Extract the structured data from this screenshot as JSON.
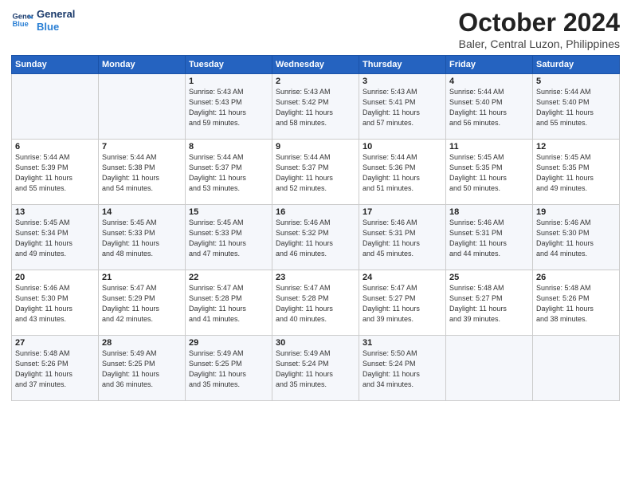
{
  "header": {
    "logo_line1": "General",
    "logo_line2": "Blue",
    "month": "October 2024",
    "location": "Baler, Central Luzon, Philippines"
  },
  "weekdays": [
    "Sunday",
    "Monday",
    "Tuesday",
    "Wednesday",
    "Thursday",
    "Friday",
    "Saturday"
  ],
  "weeks": [
    [
      {
        "day": "",
        "info": ""
      },
      {
        "day": "",
        "info": ""
      },
      {
        "day": "1",
        "info": "Sunrise: 5:43 AM\nSunset: 5:43 PM\nDaylight: 11 hours\nand 59 minutes."
      },
      {
        "day": "2",
        "info": "Sunrise: 5:43 AM\nSunset: 5:42 PM\nDaylight: 11 hours\nand 58 minutes."
      },
      {
        "day": "3",
        "info": "Sunrise: 5:43 AM\nSunset: 5:41 PM\nDaylight: 11 hours\nand 57 minutes."
      },
      {
        "day": "4",
        "info": "Sunrise: 5:44 AM\nSunset: 5:40 PM\nDaylight: 11 hours\nand 56 minutes."
      },
      {
        "day": "5",
        "info": "Sunrise: 5:44 AM\nSunset: 5:40 PM\nDaylight: 11 hours\nand 55 minutes."
      }
    ],
    [
      {
        "day": "6",
        "info": "Sunrise: 5:44 AM\nSunset: 5:39 PM\nDaylight: 11 hours\nand 55 minutes."
      },
      {
        "day": "7",
        "info": "Sunrise: 5:44 AM\nSunset: 5:38 PM\nDaylight: 11 hours\nand 54 minutes."
      },
      {
        "day": "8",
        "info": "Sunrise: 5:44 AM\nSunset: 5:37 PM\nDaylight: 11 hours\nand 53 minutes."
      },
      {
        "day": "9",
        "info": "Sunrise: 5:44 AM\nSunset: 5:37 PM\nDaylight: 11 hours\nand 52 minutes."
      },
      {
        "day": "10",
        "info": "Sunrise: 5:44 AM\nSunset: 5:36 PM\nDaylight: 11 hours\nand 51 minutes."
      },
      {
        "day": "11",
        "info": "Sunrise: 5:45 AM\nSunset: 5:35 PM\nDaylight: 11 hours\nand 50 minutes."
      },
      {
        "day": "12",
        "info": "Sunrise: 5:45 AM\nSunset: 5:35 PM\nDaylight: 11 hours\nand 49 minutes."
      }
    ],
    [
      {
        "day": "13",
        "info": "Sunrise: 5:45 AM\nSunset: 5:34 PM\nDaylight: 11 hours\nand 49 minutes."
      },
      {
        "day": "14",
        "info": "Sunrise: 5:45 AM\nSunset: 5:33 PM\nDaylight: 11 hours\nand 48 minutes."
      },
      {
        "day": "15",
        "info": "Sunrise: 5:45 AM\nSunset: 5:33 PM\nDaylight: 11 hours\nand 47 minutes."
      },
      {
        "day": "16",
        "info": "Sunrise: 5:46 AM\nSunset: 5:32 PM\nDaylight: 11 hours\nand 46 minutes."
      },
      {
        "day": "17",
        "info": "Sunrise: 5:46 AM\nSunset: 5:31 PM\nDaylight: 11 hours\nand 45 minutes."
      },
      {
        "day": "18",
        "info": "Sunrise: 5:46 AM\nSunset: 5:31 PM\nDaylight: 11 hours\nand 44 minutes."
      },
      {
        "day": "19",
        "info": "Sunrise: 5:46 AM\nSunset: 5:30 PM\nDaylight: 11 hours\nand 44 minutes."
      }
    ],
    [
      {
        "day": "20",
        "info": "Sunrise: 5:46 AM\nSunset: 5:30 PM\nDaylight: 11 hours\nand 43 minutes."
      },
      {
        "day": "21",
        "info": "Sunrise: 5:47 AM\nSunset: 5:29 PM\nDaylight: 11 hours\nand 42 minutes."
      },
      {
        "day": "22",
        "info": "Sunrise: 5:47 AM\nSunset: 5:28 PM\nDaylight: 11 hours\nand 41 minutes."
      },
      {
        "day": "23",
        "info": "Sunrise: 5:47 AM\nSunset: 5:28 PM\nDaylight: 11 hours\nand 40 minutes."
      },
      {
        "day": "24",
        "info": "Sunrise: 5:47 AM\nSunset: 5:27 PM\nDaylight: 11 hours\nand 39 minutes."
      },
      {
        "day": "25",
        "info": "Sunrise: 5:48 AM\nSunset: 5:27 PM\nDaylight: 11 hours\nand 39 minutes."
      },
      {
        "day": "26",
        "info": "Sunrise: 5:48 AM\nSunset: 5:26 PM\nDaylight: 11 hours\nand 38 minutes."
      }
    ],
    [
      {
        "day": "27",
        "info": "Sunrise: 5:48 AM\nSunset: 5:26 PM\nDaylight: 11 hours\nand 37 minutes."
      },
      {
        "day": "28",
        "info": "Sunrise: 5:49 AM\nSunset: 5:25 PM\nDaylight: 11 hours\nand 36 minutes."
      },
      {
        "day": "29",
        "info": "Sunrise: 5:49 AM\nSunset: 5:25 PM\nDaylight: 11 hours\nand 35 minutes."
      },
      {
        "day": "30",
        "info": "Sunrise: 5:49 AM\nSunset: 5:24 PM\nDaylight: 11 hours\nand 35 minutes."
      },
      {
        "day": "31",
        "info": "Sunrise: 5:50 AM\nSunset: 5:24 PM\nDaylight: 11 hours\nand 34 minutes."
      },
      {
        "day": "",
        "info": ""
      },
      {
        "day": "",
        "info": ""
      }
    ]
  ]
}
